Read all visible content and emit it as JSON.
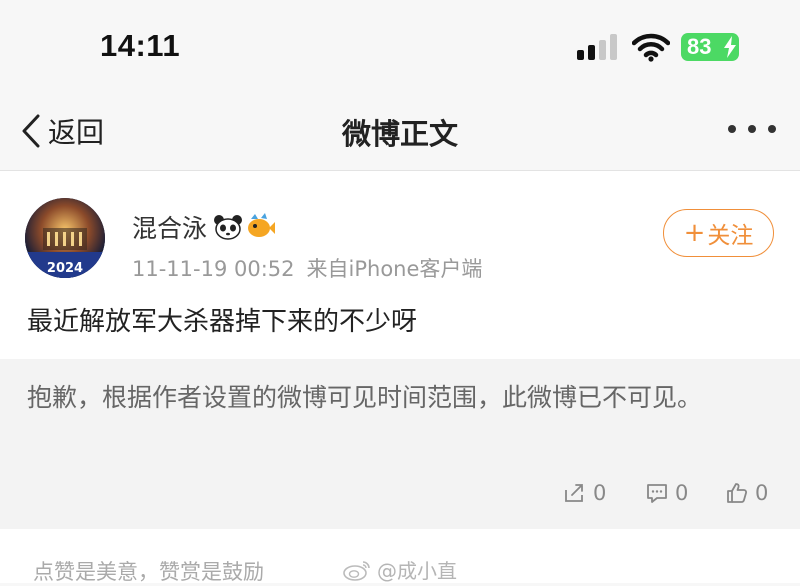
{
  "status_bar": {
    "time": "14:11",
    "battery": "83"
  },
  "nav": {
    "back_label": "返回",
    "title": "微博正文"
  },
  "post": {
    "username": "混合泳",
    "timestamp": "11-11-19 00:52",
    "source": "来自iPhone客户端",
    "follow_label": "关注",
    "text": "最近解放军大杀器掉下来的不少呀",
    "avatar_caption": "2024"
  },
  "notice": {
    "text": "抱歉，根据作者设置的微博可见时间范围，此微博已不可见。"
  },
  "actions": {
    "repost_count": "0",
    "comment_count": "0",
    "like_count": "0"
  },
  "footer": {
    "text": "点赞是美意，赞赏是鼓励",
    "watermark": "@成小直"
  },
  "colors": {
    "accent": "#f08f3a",
    "battery": "#4cd964"
  }
}
